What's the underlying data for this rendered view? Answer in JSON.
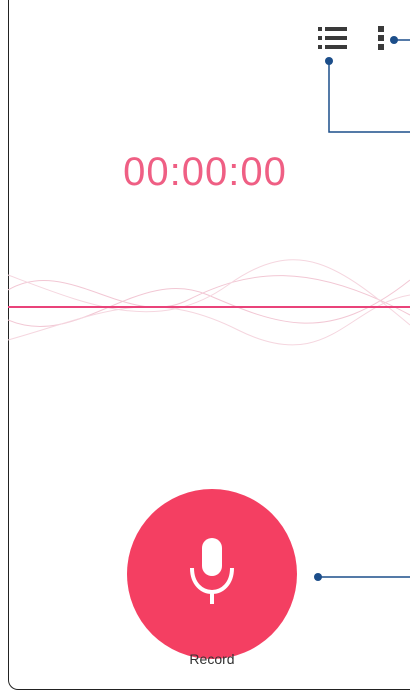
{
  "recorder": {
    "timer": "00:00:00",
    "record_label": "Record"
  },
  "icons": {
    "recordings_list": "list-icon",
    "more_options": "more-vert-icon",
    "microphone": "microphone-icon"
  },
  "colors": {
    "accent": "#f43f62",
    "timer_text": "#ef5f84",
    "waveform": "#e9437a",
    "callout_line": "#1c4e8a",
    "background": "#ffffff"
  }
}
